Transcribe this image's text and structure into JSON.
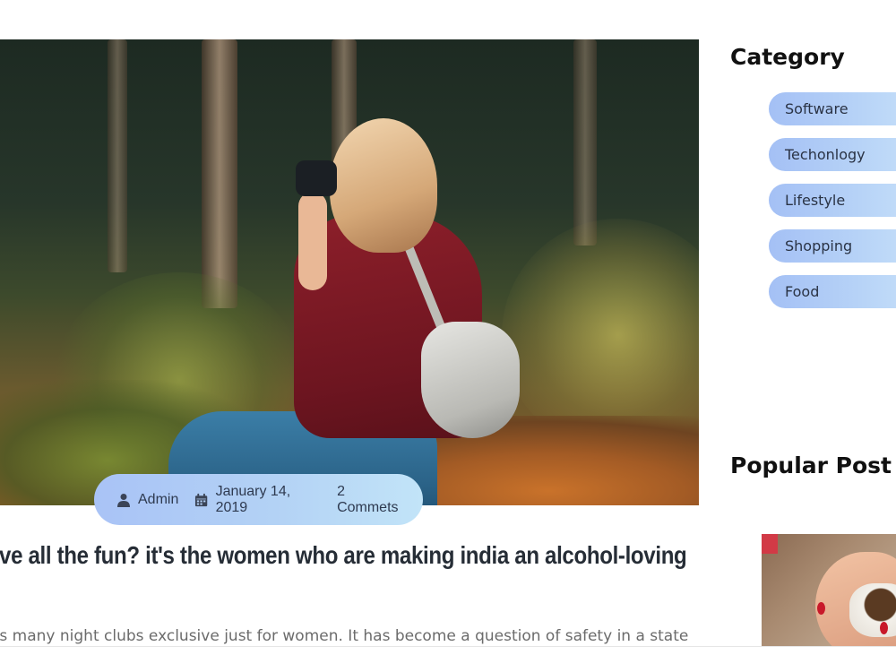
{
  "post": {
    "meta": {
      "author": "Admin",
      "date": "January 14, 2019",
      "comments": "2 Commets"
    },
    "title": "ave all the fun? it's the women who are making india an alcohol-loving",
    "excerpt": "as many night clubs exclusive just for women. It has become a question of safety in a state"
  },
  "sidebar": {
    "category_heading": "Category",
    "categories": [
      {
        "label": "Software"
      },
      {
        "label": "Techonlogy"
      },
      {
        "label": "Lifestyle"
      },
      {
        "label": "Shopping"
      },
      {
        "label": "Food"
      }
    ],
    "popular_heading": "Popular Post"
  },
  "icons": {
    "author": "user-icon",
    "date": "calendar-icon"
  },
  "colors": {
    "pill_gradient_start": "#a4c0f5",
    "pill_gradient_end": "#c6e0f9",
    "title_text": "#262d36",
    "heading_text": "#111111"
  }
}
